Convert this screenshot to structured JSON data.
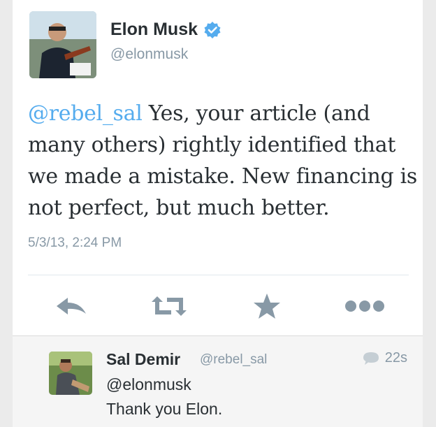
{
  "tweet": {
    "author_name": "Elon Musk",
    "author_handle": "@elonmusk",
    "verified_icon": "verified-badge-icon",
    "mention": "@rebel_sal",
    "text": " Yes, your article (and many others) rightly identified that we made a mistake. New financing is not perfect, but much better.",
    "timestamp": "5/3/13, 2:24 PM"
  },
  "actions": [
    {
      "name": "reply",
      "icon": "reply-arrow-icon"
    },
    {
      "name": "retweet",
      "icon": "retweet-icon"
    },
    {
      "name": "favorite",
      "icon": "star-icon"
    },
    {
      "name": "more",
      "icon": "more-dots-icon"
    }
  ],
  "reply": {
    "author_name": "Sal Demir",
    "author_handle": "@rebel_sal",
    "time": "22s",
    "line1": "@elonmusk",
    "line2": "Thank you Elon."
  },
  "colors": {
    "accent": "#55acee",
    "text": "#292f33",
    "muted": "#8899a6",
    "icon": "#8899a6"
  }
}
